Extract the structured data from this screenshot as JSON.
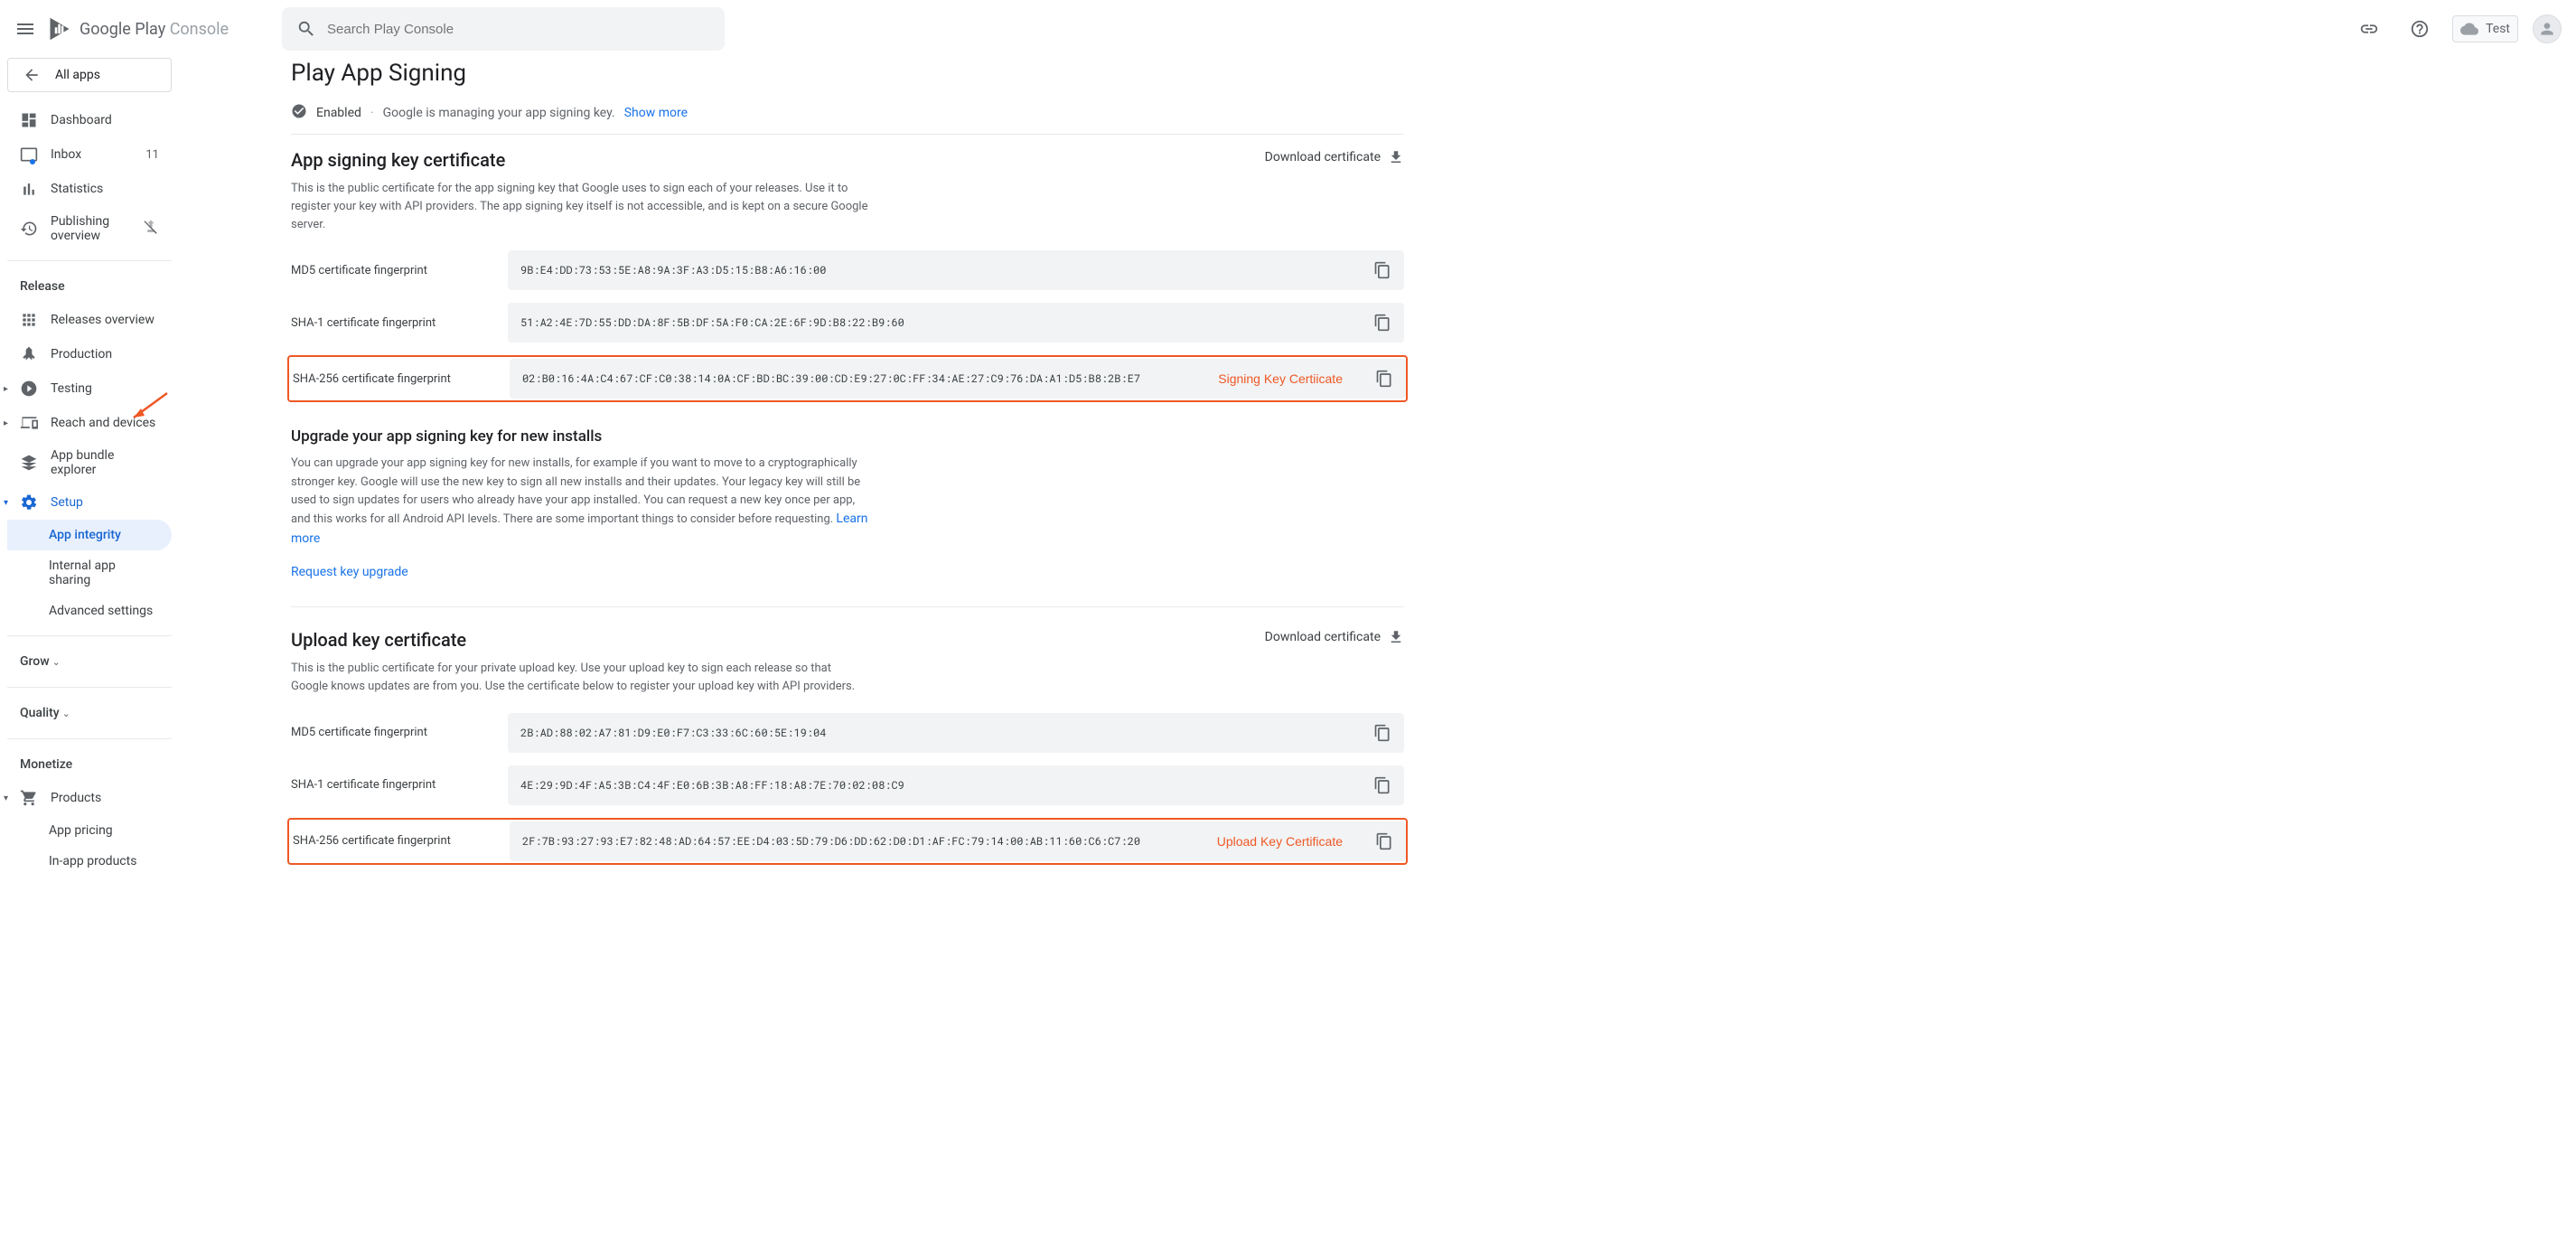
{
  "header": {
    "logo": {
      "google": "Google",
      "play": "Play",
      "console": "Console"
    },
    "search_placeholder": "Search Play Console",
    "test_chip": "Test"
  },
  "sidebar": {
    "all_apps": "All apps",
    "items": {
      "dashboard": "Dashboard",
      "inbox": "Inbox",
      "inbox_badge": "11",
      "statistics": "Statistics",
      "publishing_overview": "Publishing overview"
    },
    "release_heading": "Release",
    "release_items": {
      "releases_overview": "Releases overview",
      "production": "Production",
      "testing": "Testing",
      "reach_devices": "Reach and devices",
      "app_bundle": "App bundle explorer",
      "setup": "Setup",
      "app_integrity": "App integrity",
      "internal_sharing": "Internal app sharing",
      "advanced": "Advanced settings"
    },
    "grow_heading": "Grow",
    "quality_heading": "Quality",
    "monetize_heading": "Monetize",
    "monetize_items": {
      "products": "Products",
      "app_pricing": "App pricing",
      "in_app": "In-app products"
    }
  },
  "page": {
    "title": "Play App Signing",
    "status": "Enabled",
    "status_desc": "Google is managing your app signing key.",
    "show_more": "Show more",
    "sections": {
      "signing": {
        "title": "App signing key certificate",
        "desc": "This is the public certificate for the app signing key that Google uses to sign each of your releases. Use it to register your key with API providers. The app signing key itself is not accessible, and is kept on a secure Google server.",
        "download": "Download certificate",
        "md5_label": "MD5 certificate fingerprint",
        "md5_value": "9B:E4:DD:73:53:5E:A8:9A:3F:A3:D5:15:B8:A6:16:00",
        "sha1_label": "SHA-1 certificate fingerprint",
        "sha1_value": "51:A2:4E:7D:55:DD:DA:8F:5B:DF:5A:F0:CA:2E:6F:9D:B8:22:B9:60",
        "sha256_label": "SHA-256 certificate fingerprint",
        "sha256_value": "02:B0:16:4A:C4:67:CF:C0:38:14:0A:CF:BD:BC:39:00:CD:E9:27:0C:FF:34:AE:27:C9:76:DA:A1:D5:B8:2B:E7",
        "sha256_annotation": "Signing Key Certiicate"
      },
      "upgrade": {
        "title": "Upgrade your app signing key for new installs",
        "desc": "You can upgrade your app signing key for new installs, for example if you want to move to a cryptographically stronger key. Google will use the new key to sign all new installs and their updates. Your legacy key will still be used to sign updates for users who already have your app installed. You can request a new key once per app, and this works for all Android API levels. There are some important things to consider before requesting.",
        "learn_more": "Learn more",
        "request": "Request key upgrade"
      },
      "upload": {
        "title": "Upload key certificate",
        "desc": "This is the public certificate for your private upload key. Use your upload key to sign each release so that Google knows updates are from you. Use the certificate below to register your upload key with API providers.",
        "download": "Download certificate",
        "md5_label": "MD5 certificate fingerprint",
        "md5_value": "2B:AD:88:02:A7:81:D9:E0:F7:C3:33:6C:60:5E:19:04",
        "sha1_label": "SHA-1 certificate fingerprint",
        "sha1_value": "4E:29:9D:4F:A5:3B:C4:4F:E0:6B:3B:A8:FF:18:A8:7E:70:02:08:C9",
        "sha256_label": "SHA-256 certificate fingerprint",
        "sha256_value": "2F:7B:93:27:93:E7:82:48:AD:64:57:EE:D4:03:5D:79:D6:DD:62:D0:D1:AF:FC:79:14:00:AB:11:60:C6:C7:20",
        "sha256_annotation": "Upload Key Certificate"
      }
    }
  }
}
